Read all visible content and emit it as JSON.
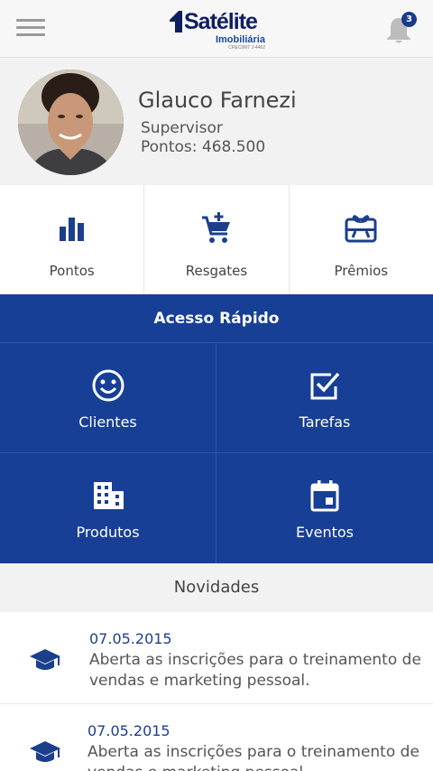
{
  "header": {
    "logo": {
      "name": "Satélite",
      "sub": "Imobiliária",
      "tiny": "CRECI/MT J-4462"
    },
    "notifications": {
      "count": "3",
      "icon": "bell-icon"
    },
    "menu_icon": "hamburger-icon"
  },
  "profile": {
    "name": "Glauco Farnezi",
    "role": "Supervisor",
    "points": "Pontos: 468.500"
  },
  "stats": [
    {
      "label": "Pontos",
      "icon": "bar-chart-icon"
    },
    {
      "label": "Resgates",
      "icon": "cart-add-icon"
    },
    {
      "label": "Prêmios",
      "icon": "gift-card-icon"
    }
  ],
  "quick_access": {
    "title": "Acesso Rápido",
    "tiles": [
      {
        "label": "Clientes",
        "icon": "smiley-icon"
      },
      {
        "label": "Tarefas",
        "icon": "checkbox-icon"
      },
      {
        "label": "Produtos",
        "icon": "building-icon"
      },
      {
        "label": "Eventos",
        "icon": "calendar-icon"
      }
    ]
  },
  "news": {
    "title": "Novidades",
    "items": [
      {
        "date": "07.05.2015",
        "text": "Aberta as inscrições para o treinamento de vendas e marketing pessoal.",
        "icon": "graduation-cap-icon"
      },
      {
        "date": "07.05.2015",
        "text": "Aberta as inscrições para o treinamento de vendas e marketing pessoal.",
        "icon": "graduation-cap-icon"
      }
    ]
  },
  "colors": {
    "primary": "#173f95",
    "icon_blue": "#1c3f8c",
    "background": "#f2f2f2"
  }
}
